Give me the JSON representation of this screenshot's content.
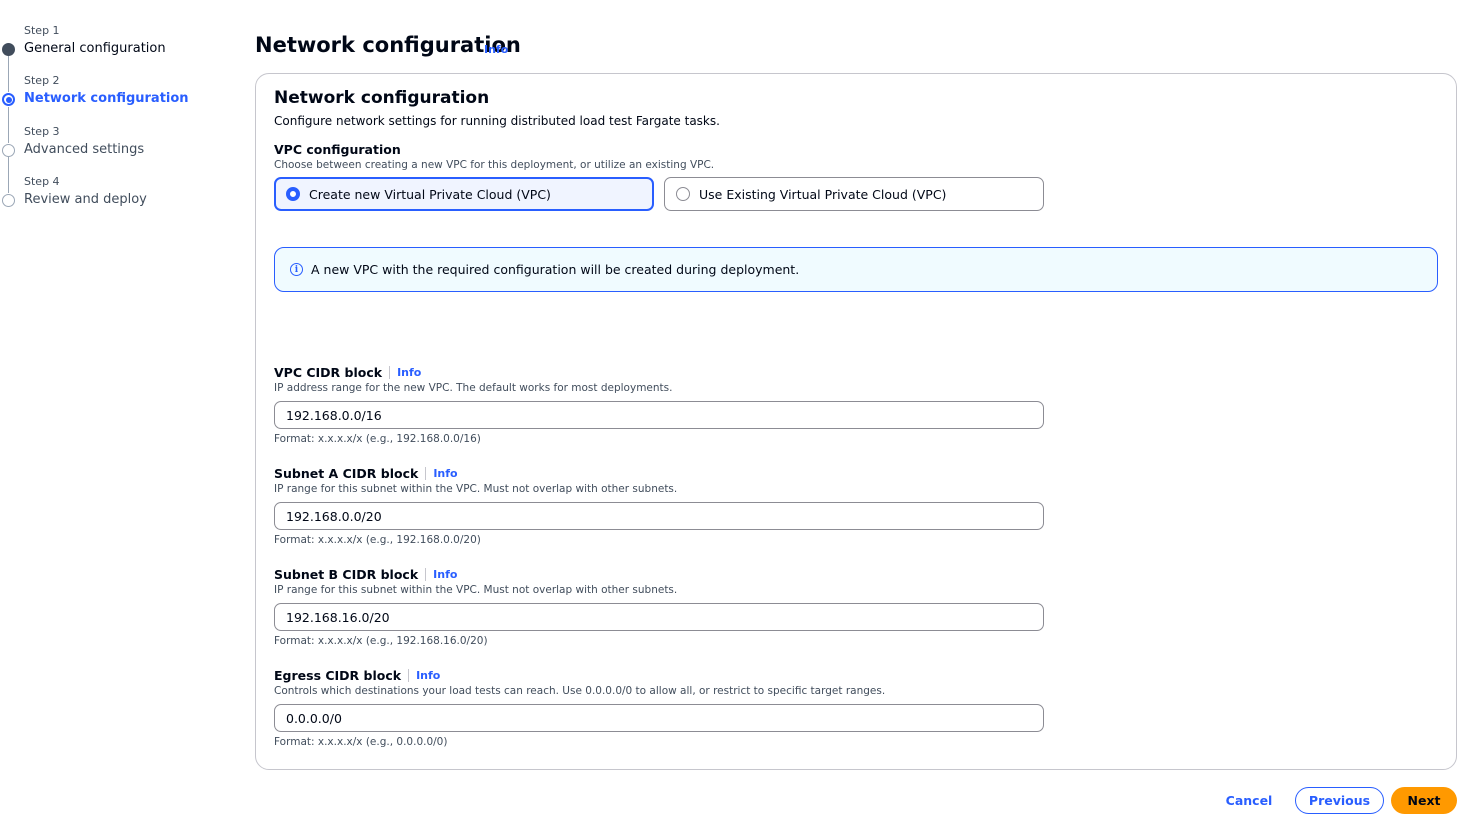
{
  "wizard": {
    "steps": [
      {
        "number": "Step 1",
        "label": "General configuration",
        "state": "done"
      },
      {
        "number": "Step 2",
        "label": "Network configuration",
        "state": "active"
      },
      {
        "number": "Step 3",
        "label": "Advanced settings",
        "state": "pending"
      },
      {
        "number": "Step 4",
        "label": "Review and deploy",
        "state": "pending"
      }
    ]
  },
  "header": {
    "title": "Network configuration",
    "info": "Info"
  },
  "container": {
    "title": "Network configuration",
    "description": "Configure network settings for running distributed load test Fargate tasks."
  },
  "vpc_config": {
    "label": "VPC configuration",
    "description": "Choose between creating a new VPC for this deployment, or utilize an existing VPC.",
    "options": [
      {
        "label": "Create new Virtual Private Cloud (VPC)",
        "selected": true
      },
      {
        "label": "Use Existing Virtual Private Cloud (VPC)",
        "selected": false
      }
    ]
  },
  "alert": {
    "icon": "info-circle-icon",
    "text": "A new VPC with the required configuration will be created during deployment."
  },
  "fields": {
    "vpc_cidr": {
      "label": "VPC CIDR block",
      "info": "Info",
      "description": "IP address range for the new VPC. The default works for most deployments.",
      "value": "192.168.0.0/16",
      "hint": "Format: x.x.x.x/x (e.g., 192.168.0.0/16)"
    },
    "subnet_a": {
      "label": "Subnet A CIDR block",
      "info": "Info",
      "description": "IP range for this subnet within the VPC. Must not overlap with other subnets.",
      "value": "192.168.0.0/20",
      "hint": "Format: x.x.x.x/x (e.g., 192.168.0.0/20)"
    },
    "subnet_b": {
      "label": "Subnet B CIDR block",
      "info": "Info",
      "description": "IP range for this subnet within the VPC. Must not overlap with other subnets.",
      "value": "192.168.16.0/20",
      "hint": "Format: x.x.x.x/x (e.g., 192.168.16.0/20)"
    },
    "egress": {
      "label": "Egress CIDR block",
      "info": "Info",
      "description": "Controls which destinations your load tests can reach. Use 0.0.0.0/0 to allow all, or restrict to specific target ranges.",
      "value": "0.0.0.0/0",
      "hint": "Format: x.x.x.x/x (e.g., 0.0.0.0/0)"
    }
  },
  "footer": {
    "cancel": "Cancel",
    "previous": "Previous",
    "next": "Next"
  },
  "colors": {
    "accent": "#295eff",
    "primary_button": "#ff9900",
    "text": "#000716"
  }
}
